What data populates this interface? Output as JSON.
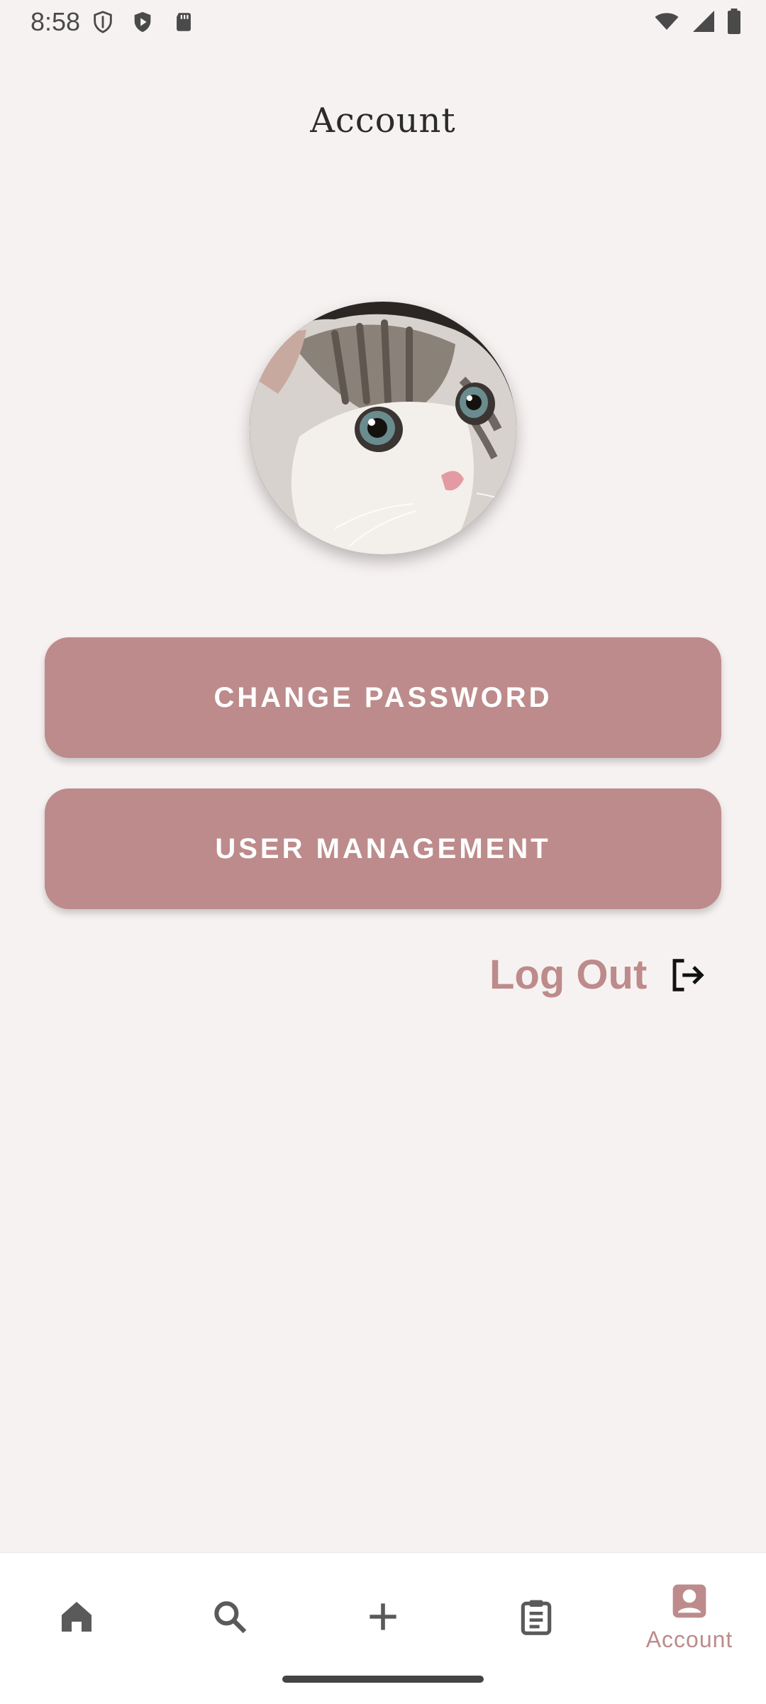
{
  "status_bar": {
    "time": "8:58"
  },
  "header": {
    "title": "Account"
  },
  "actions": {
    "change_password": "CHANGE PASSWORD",
    "user_management": "USER MANAGEMENT",
    "logout": "Log Out"
  },
  "bottom_nav": {
    "items": [
      {
        "icon": "home-icon",
        "label": ""
      },
      {
        "icon": "search-icon",
        "label": ""
      },
      {
        "icon": "plus-icon",
        "label": ""
      },
      {
        "icon": "clipboard-icon",
        "label": ""
      },
      {
        "icon": "account-icon",
        "label": "Account"
      }
    ]
  },
  "colors": {
    "accent": "#bd8b8b",
    "background": "#f7f2f2",
    "nav_inactive": "#5a5a5a"
  }
}
